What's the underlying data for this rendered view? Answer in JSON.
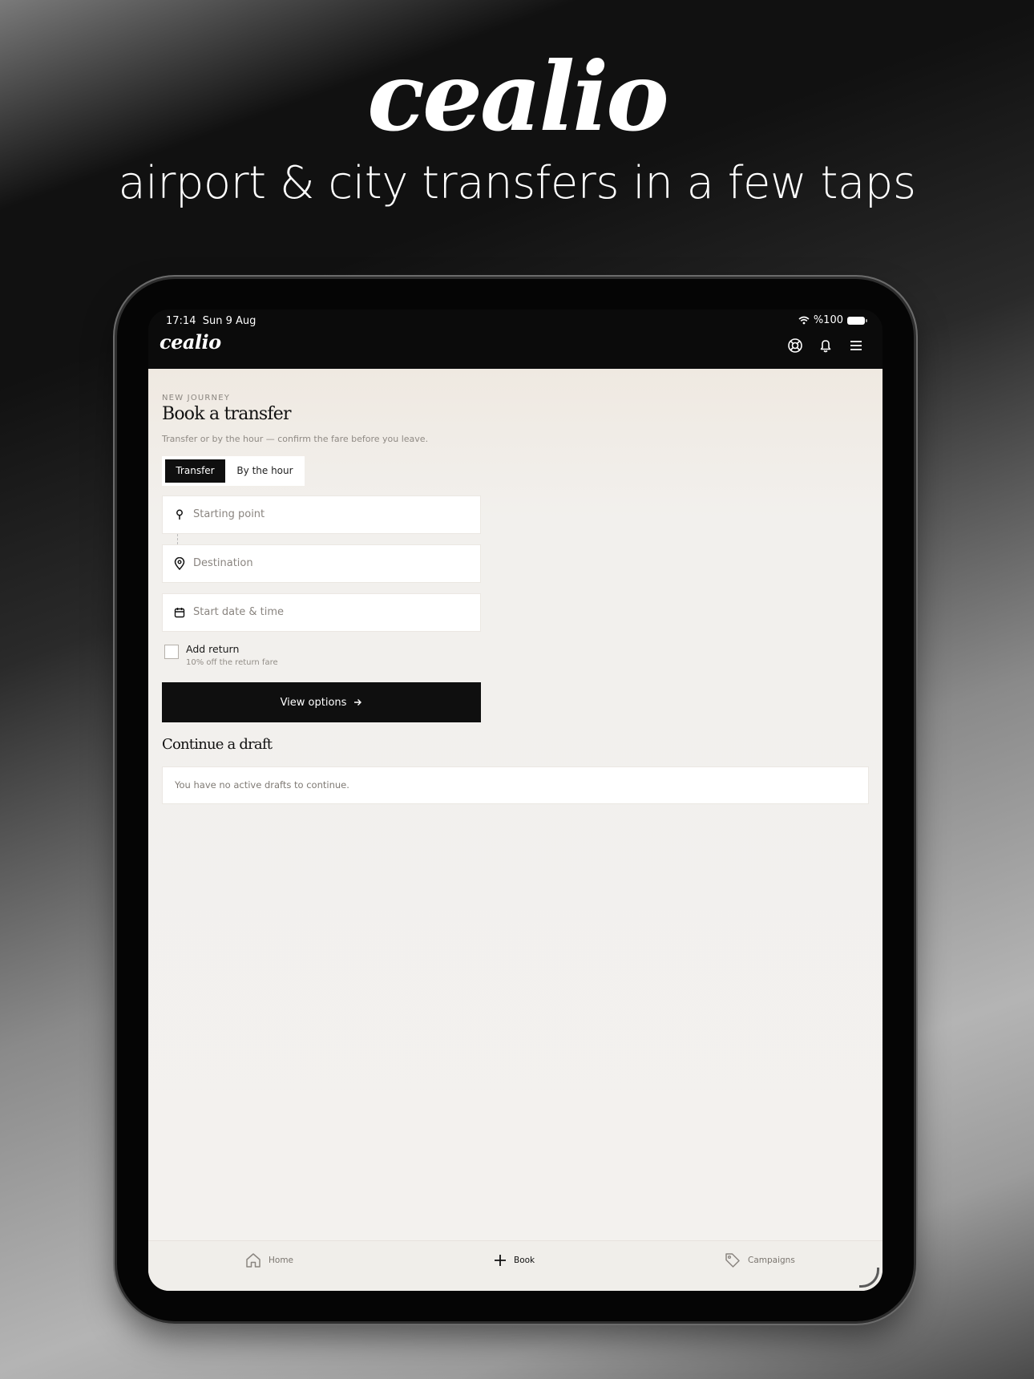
{
  "promo": {
    "logo": "cealio",
    "tagline": "airport & city transfers in a few taps"
  },
  "status_bar": {
    "time": "17:14",
    "date": "Sun 9 Aug",
    "battery": "%100"
  },
  "header": {
    "logo": "cealio",
    "icons": [
      "lifebuoy-icon",
      "bell-icon",
      "menu-icon"
    ]
  },
  "booking": {
    "eyebrow": "NEW JOURNEY",
    "title": "Book a transfer",
    "subtitle": "Transfer or by the hour — confirm the fare before you leave.",
    "tabs": [
      "Transfer",
      "By the hour"
    ],
    "active_tab": "Transfer",
    "fields": {
      "start": "Starting point",
      "destination": "Destination",
      "datetime": "Start date & time"
    },
    "return_label": "Add return",
    "return_sub": "10% off the return fare",
    "return_checked": false,
    "cta": "View options"
  },
  "drafts": {
    "title": "Continue a draft",
    "empty": "You have no active drafts to continue."
  },
  "tabbar": {
    "home": "Home",
    "book": "Book",
    "campaigns": "Campaigns",
    "active": "Book"
  },
  "colors": {
    "primary": "#0f0f0f",
    "background": "#f3f1ee",
    "muted_text": "#8a8580"
  }
}
